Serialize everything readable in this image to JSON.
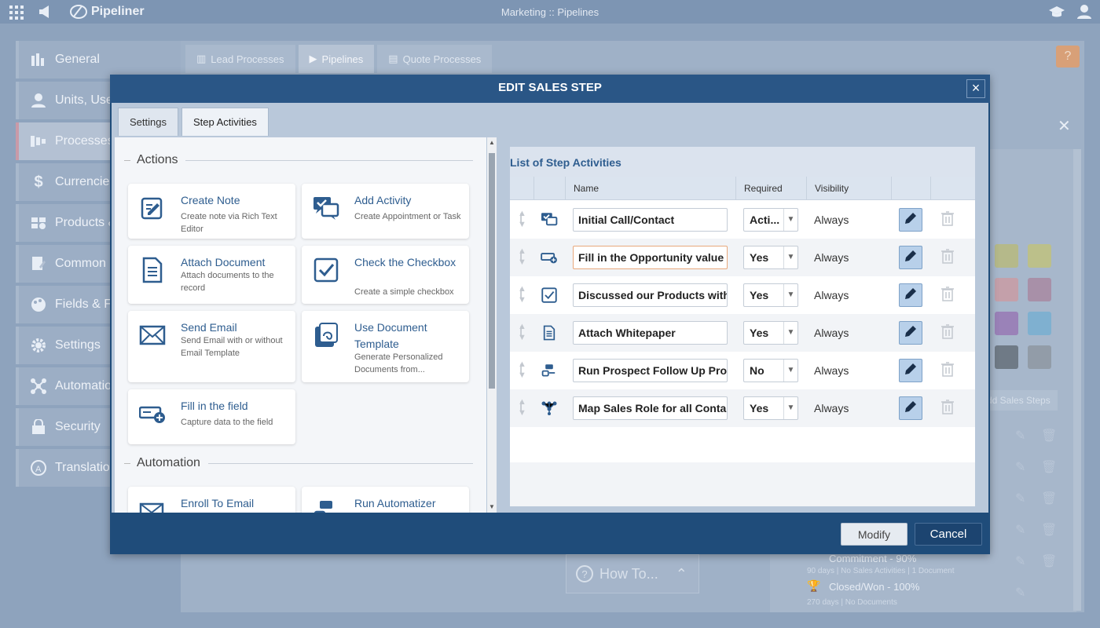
{
  "app": {
    "brand": "Pipeliner",
    "window_title": "Marketing :: Pipelines"
  },
  "sidebar": {
    "items": [
      {
        "label": "General",
        "icon": "chart-bars-icon"
      },
      {
        "label": "Units, Use",
        "icon": "user-icon"
      },
      {
        "label": "Processes",
        "icon": "pipeline-icon"
      },
      {
        "label": "Currencies",
        "icon": "dollar-icon"
      },
      {
        "label": "Products &",
        "icon": "products-icon"
      },
      {
        "label": "Common F",
        "icon": "edit-document-icon"
      },
      {
        "label": "Fields & Fo",
        "icon": "palette-icon"
      },
      {
        "label": "Settings",
        "icon": "gear-icon"
      },
      {
        "label": "Automatio",
        "icon": "network-icon"
      },
      {
        "label": "Security",
        "icon": "lock-icon"
      },
      {
        "label": "Translatio",
        "icon": "translate-icon"
      }
    ]
  },
  "background": {
    "tabs": [
      "Lead Processes",
      "Pipelines",
      "Quote Processes"
    ],
    "help": "?",
    "add_sales_steps": "dd Sales Steps",
    "steps": [
      {
        "title": "Commitment - 90%",
        "sub": "90 days | No Sales Activities | 1 Document"
      },
      {
        "title": "Closed/Won - 100%",
        "sub": "270 days | No Documents"
      }
    ],
    "how_to": "How To..."
  },
  "modal": {
    "title": "EDIT SALES STEP",
    "close": "×",
    "tabs": [
      "Settings",
      "Step Activities"
    ],
    "active_tab": 1,
    "palette": {
      "sections": [
        "Actions",
        "Automation"
      ],
      "cards": [
        {
          "title": "Create Note",
          "desc": "Create note via Rich Text Editor",
          "icon": "create-note-icon"
        },
        {
          "title": "Add Activity",
          "desc": "Create Appointment or Task",
          "icon": "add-activity-icon"
        },
        {
          "title": "Attach Document",
          "desc": "Attach documents to the record",
          "icon": "document-icon"
        },
        {
          "title": "Check the Checkbox",
          "desc": "Create a simple checkbox",
          "icon": "checkbox-icon"
        },
        {
          "title": "Send Email",
          "desc": "Send Email with or without Email Template",
          "icon": "envelope-icon"
        },
        {
          "title": "Use Document Template",
          "desc": "Generate Personalized Documents from...",
          "icon": "document-template-icon"
        },
        {
          "title": "Fill in the field",
          "desc": "Capture data to the field",
          "icon": "fill-field-icon"
        },
        {
          "title": "Enroll To Email",
          "desc": "",
          "icon": "enroll-email-icon"
        },
        {
          "title": "Run Automatizer",
          "desc": "",
          "icon": "automatizer-icon"
        }
      ]
    },
    "list": {
      "title": "List of Step Activities",
      "columns": [
        "Name",
        "Required",
        "Visibility"
      ],
      "rows": [
        {
          "icon": "add-activity-icon",
          "name": "Initial Call/Contact",
          "required": "Acti...",
          "visibility": "Always"
        },
        {
          "icon": "fill-field-icon",
          "name": "Fill in the Opportunity value",
          "required": "Yes",
          "visibility": "Always"
        },
        {
          "icon": "checkbox-icon",
          "name": "Discussed our Products with",
          "required": "Yes",
          "visibility": "Always"
        },
        {
          "icon": "document-icon",
          "name": "Attach Whitepaper",
          "required": "Yes",
          "visibility": "Always"
        },
        {
          "icon": "automatizer-icon",
          "name": "Run Prospect Follow Up Pro",
          "required": "No",
          "visibility": "Always"
        },
        {
          "icon": "sales-role-icon",
          "name": "Map Sales Role for all Conta",
          "required": "Yes",
          "visibility": "Always"
        }
      ]
    },
    "buttons": {
      "modify": "Modify",
      "cancel": "Cancel"
    }
  },
  "colors": {
    "accent": "#2e5d8f",
    "modal_frame": "#1f4c7a",
    "cancel": "#1c4470",
    "edit_button": "#b8d0ea"
  }
}
